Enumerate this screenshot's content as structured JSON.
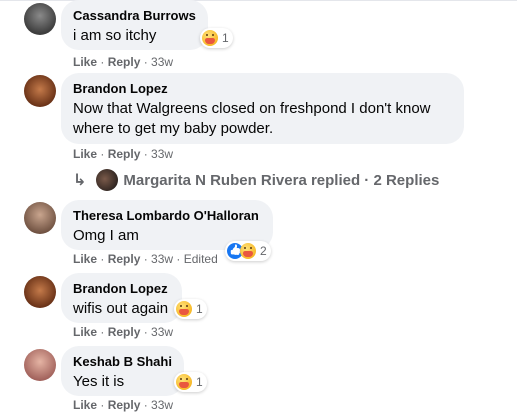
{
  "comments": [
    {
      "author": "Cassandra Burrows",
      "text": "i am so itchy",
      "like": "Like",
      "reply": "Reply",
      "time": "33w",
      "edited": "",
      "reaction_count": "1",
      "avatar_color": "#5b5b5b"
    },
    {
      "author": "Brandon Lopez",
      "text_line1": "Now that Walgreens closed on freshpond I don't know",
      "text_line2": "where to get my baby powder.",
      "like": "Like",
      "reply": "Reply",
      "time": "33w",
      "avatar_color": "#8a4a2a"
    },
    {
      "author": "Theresa Lombardo O'Halloran",
      "text": "Omg I am",
      "like": "Like",
      "reply": "Reply",
      "time": "33w",
      "edited": "Edited",
      "reaction_count": "2",
      "avatar_color": "#9a7a6a"
    },
    {
      "author": "Brandon Lopez",
      "text": "wifis out again",
      "like": "Like",
      "reply": "Reply",
      "time": "33w",
      "reaction_count": "1",
      "avatar_color": "#8a4a2a"
    },
    {
      "author": "Keshab B Shahi",
      "text": "Yes it is",
      "like": "Like",
      "reply": "Reply",
      "time": "33w",
      "reaction_count": "1",
      "avatar_color": "#c98a7a"
    }
  ],
  "replies_summary": {
    "text": "Margarita N Ruben Rivera replied · 2 Replies",
    "icon": "reply-arrow-icon"
  },
  "separator": " · ",
  "colors": {
    "bubble": "#f0f2f5",
    "meta": "#65676b",
    "like_blue": "#1877f2",
    "care_yellow": "#f7b928"
  }
}
